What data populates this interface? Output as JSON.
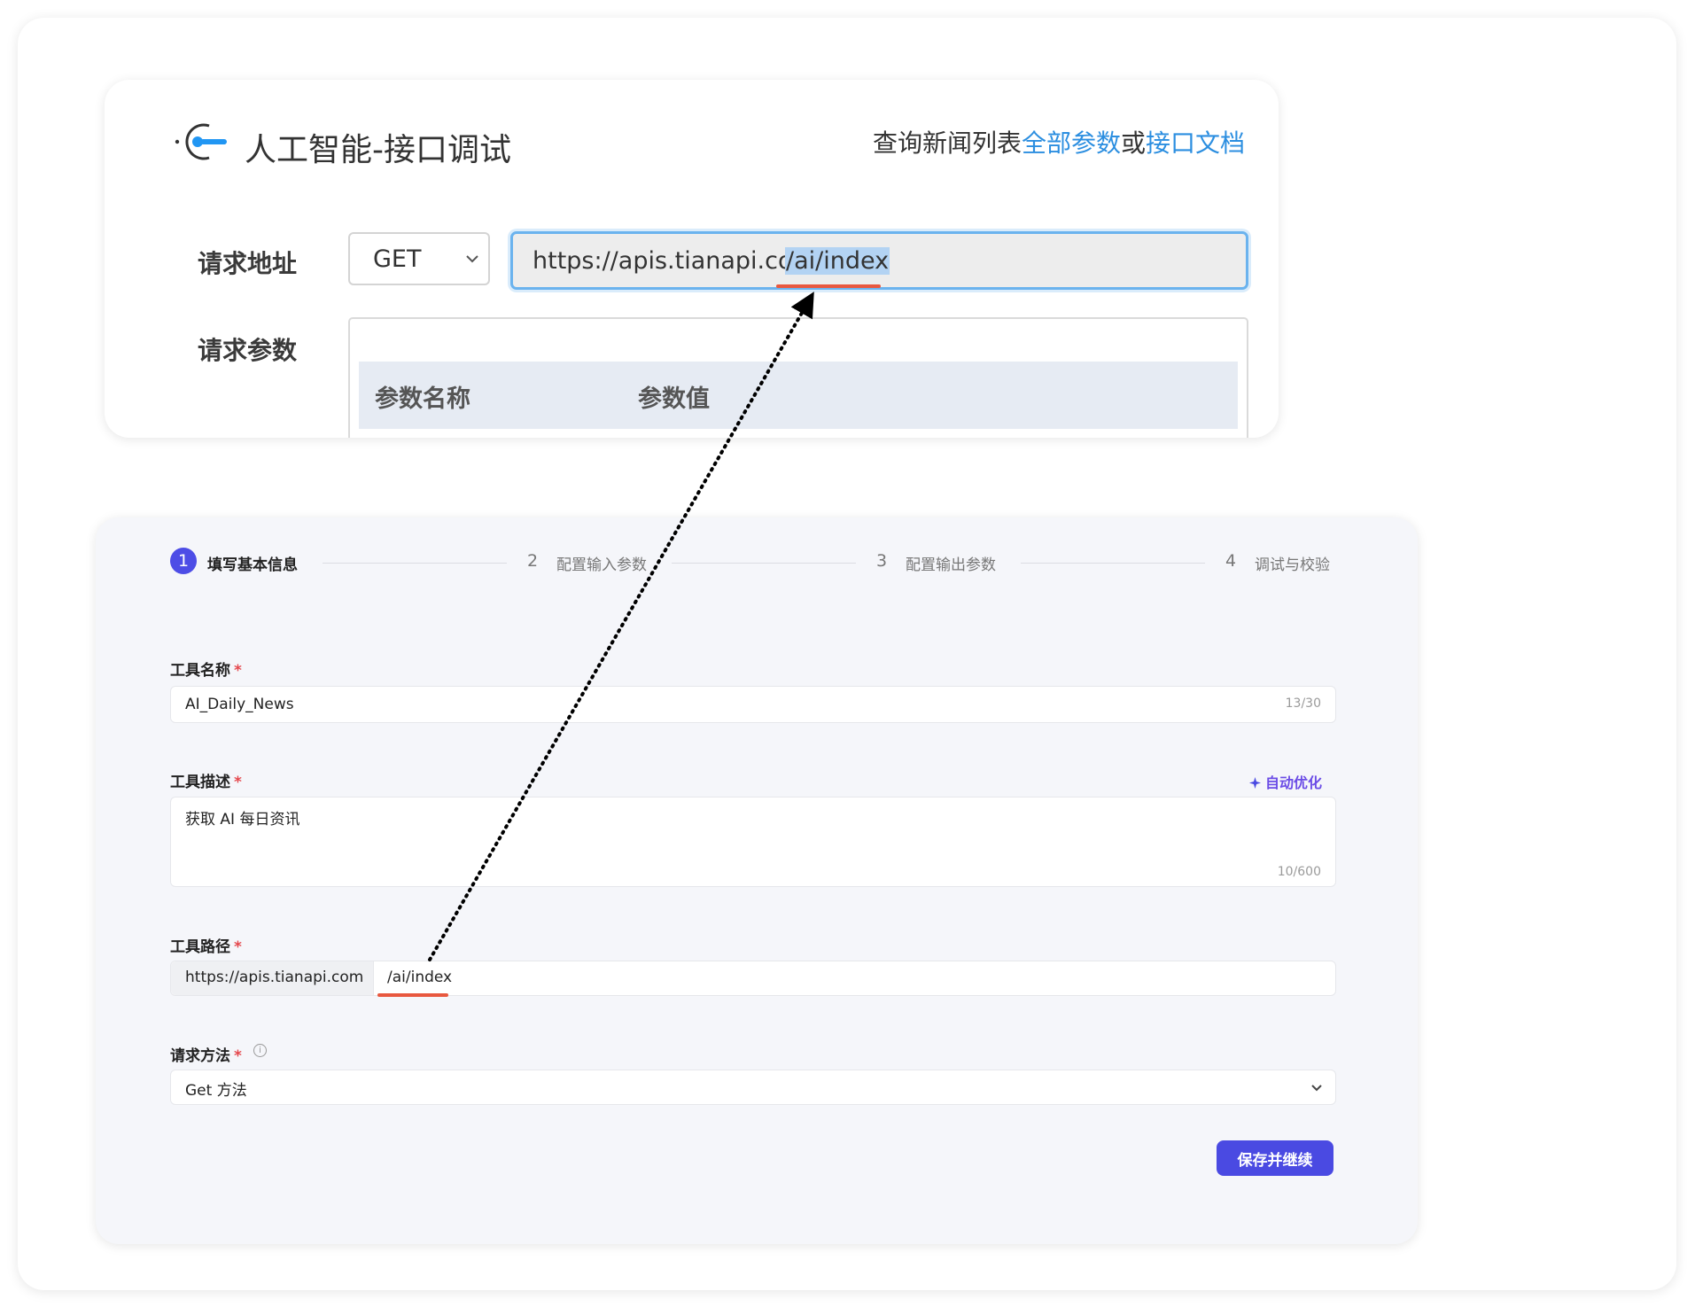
{
  "top_panel": {
    "title": "人工智能-接口调试",
    "header_prefix": "查询新闻列表",
    "all_params_link": "全部参数",
    "or_text": "或",
    "api_docs_link": "接口文档",
    "request_url_label": "请求地址",
    "method_value": "GET",
    "url_base": "https://apis.tianapi.com",
    "url_path": "/ai/index",
    "request_params_label": "请求参数",
    "param_name_header": "参数名称",
    "param_value_header": "参数值"
  },
  "wizard": {
    "steps": [
      {
        "num": "1",
        "label": "填写基本信息",
        "active": true
      },
      {
        "num": "2",
        "label": "配置输入参数",
        "active": false
      },
      {
        "num": "3",
        "label": "配置输出参数",
        "active": false
      },
      {
        "num": "4",
        "label": "调试与校验",
        "active": false
      }
    ],
    "required_mark": "*",
    "tool_name": {
      "label": "工具名称",
      "value": "AI_Daily_News",
      "counter": "13/30"
    },
    "tool_desc": {
      "label": "工具描述",
      "value": "获取 AI 每日资讯",
      "counter": "10/600",
      "auto_optimize": "自动优化"
    },
    "tool_path": {
      "label": "工具路径",
      "prefix": "https://apis.tianapi.com",
      "value": "/ai/index"
    },
    "request_method": {
      "label": "请求方法",
      "value": "Get 方法"
    },
    "save_button": "保存并继续"
  },
  "colors": {
    "accent": "#4a4ae2",
    "link": "#2b8ee0",
    "underline": "#e8583f",
    "required": "#e5484d"
  }
}
